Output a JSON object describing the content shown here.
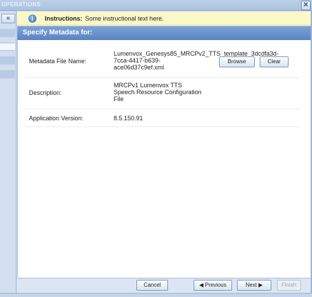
{
  "titlebar": {
    "title": "OPERATIONS"
  },
  "instructions": {
    "label": "Instructions:",
    "text": "Some instructional text here."
  },
  "header": {
    "title": "Specify Metadata for:"
  },
  "form": {
    "metadata_file": {
      "label": "Metadata File Name:",
      "value_lines": [
        "Lumenvox_Genesys85_MRCPv2_TTS_template_3dcdfa3d-",
        "7cca-4417-b639-",
        "ace06d37c9ef.xml"
      ],
      "browse_label": "Browse",
      "clear_label": "Clear"
    },
    "description": {
      "label": "Description:",
      "value_lines": [
        "MRCPv1 Lumenvox TTS",
        "Speech Resource Configuration",
        "File"
      ]
    },
    "app_version": {
      "label": "Application Version:",
      "value": "8.5.150.91"
    }
  },
  "footer": {
    "cancel_label": "Cancel",
    "previous_label": "Previous",
    "next_label": "Next",
    "finish_label": "Finish"
  },
  "icons": {
    "close": "close-icon",
    "collapse": "collapse-left-icon",
    "info": "info-icon"
  }
}
